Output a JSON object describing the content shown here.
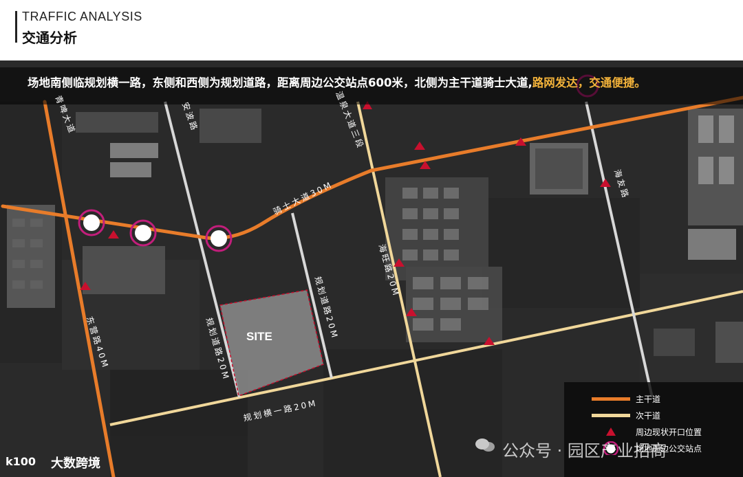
{
  "header": {
    "title_en": "TRAFFIC ANALYSIS",
    "title_zh": "交通分析"
  },
  "caption": {
    "text": "场地南侧临规划横一路，东侧和西侧为规划道路，距离周边公交站点600米，北侧为主干道骑士大道,",
    "highlight": "路网发达，交通便捷。"
  },
  "roads": {
    "qishi": "骑士大道30M",
    "wenquan": "温泉大道三段",
    "qingpi": "青啤大道",
    "anbo": "安波路",
    "haiyou": "海友路",
    "haiwang": "海旺路20M",
    "guihua_east": "规划道路20M",
    "guihua_west": "规划道路20M",
    "guihua_heng": "规划横一路20M",
    "donghai": "东营路40M"
  },
  "site_label": "SITE",
  "legend": {
    "items": [
      {
        "label": "主干道",
        "color": "#e87c2a"
      },
      {
        "label": "次干道",
        "color": "#f0d79a"
      },
      {
        "label": "周边现状开口位置",
        "color": "#c8102e"
      },
      {
        "label": "场地周边公交站点",
        "color": "#c21e7b"
      }
    ]
  },
  "watermark": "公众号 · 园区产业招商",
  "brand": {
    "logo": "k100",
    "name": "大数跨境"
  },
  "colors": {
    "main_road": "#e87c2a",
    "secondary_road": "#f0d79a",
    "opening_marker": "#c8102e",
    "bus_stop": "#c21e7b",
    "caption_highlight": "#f2b23a"
  }
}
